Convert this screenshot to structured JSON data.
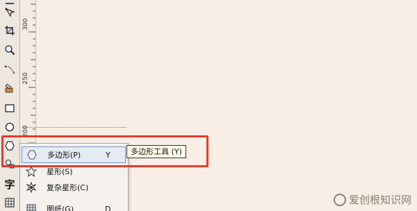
{
  "toolbox": {
    "tools": [
      {
        "name": "pick-tool",
        "icon": "arrow-icon"
      },
      {
        "name": "shape-tool",
        "icon": "shape-edit-icon"
      },
      {
        "name": "crop-tool",
        "icon": "crop-icon"
      },
      {
        "name": "zoom-tool",
        "icon": "magnifier-icon"
      },
      {
        "name": "curve-tool",
        "icon": "curve-icon"
      },
      {
        "name": "smart-fill-tool",
        "icon": "smart-fill-icon"
      },
      {
        "name": "rectangle-tool",
        "icon": "rectangle-icon"
      },
      {
        "name": "ellipse-tool",
        "icon": "ellipse-icon"
      },
      {
        "name": "polygon-tool",
        "icon": "polygon-icon"
      },
      {
        "name": "basic-shapes-tool",
        "icon": "shapes-icon"
      },
      {
        "name": "text-tool",
        "label": "字"
      },
      {
        "name": "table-tool",
        "icon": "table-icon"
      }
    ]
  },
  "ruler": {
    "labels": [
      "300",
      "250",
      "200"
    ]
  },
  "flyout": {
    "items": [
      {
        "label": "多边形(P)",
        "shortcut": "Y",
        "icon": "polygon-icon",
        "selected": true
      },
      {
        "label": "星形(S)",
        "shortcut": "",
        "icon": "star-icon",
        "selected": false
      },
      {
        "label": "复杂星形(C)",
        "shortcut": "",
        "icon": "complex-star-icon",
        "selected": false
      },
      {
        "label": "图纸(G)",
        "shortcut": "D",
        "icon": "graph-paper-icon",
        "selected": false
      }
    ]
  },
  "tooltip": {
    "text": "多边形工具 (Y)"
  },
  "watermark": {
    "text": "爱创根知识网"
  },
  "colors": {
    "canvas": "#f9eee5",
    "highlight": "#e53b2c",
    "selection_border": "#6f93bf"
  }
}
